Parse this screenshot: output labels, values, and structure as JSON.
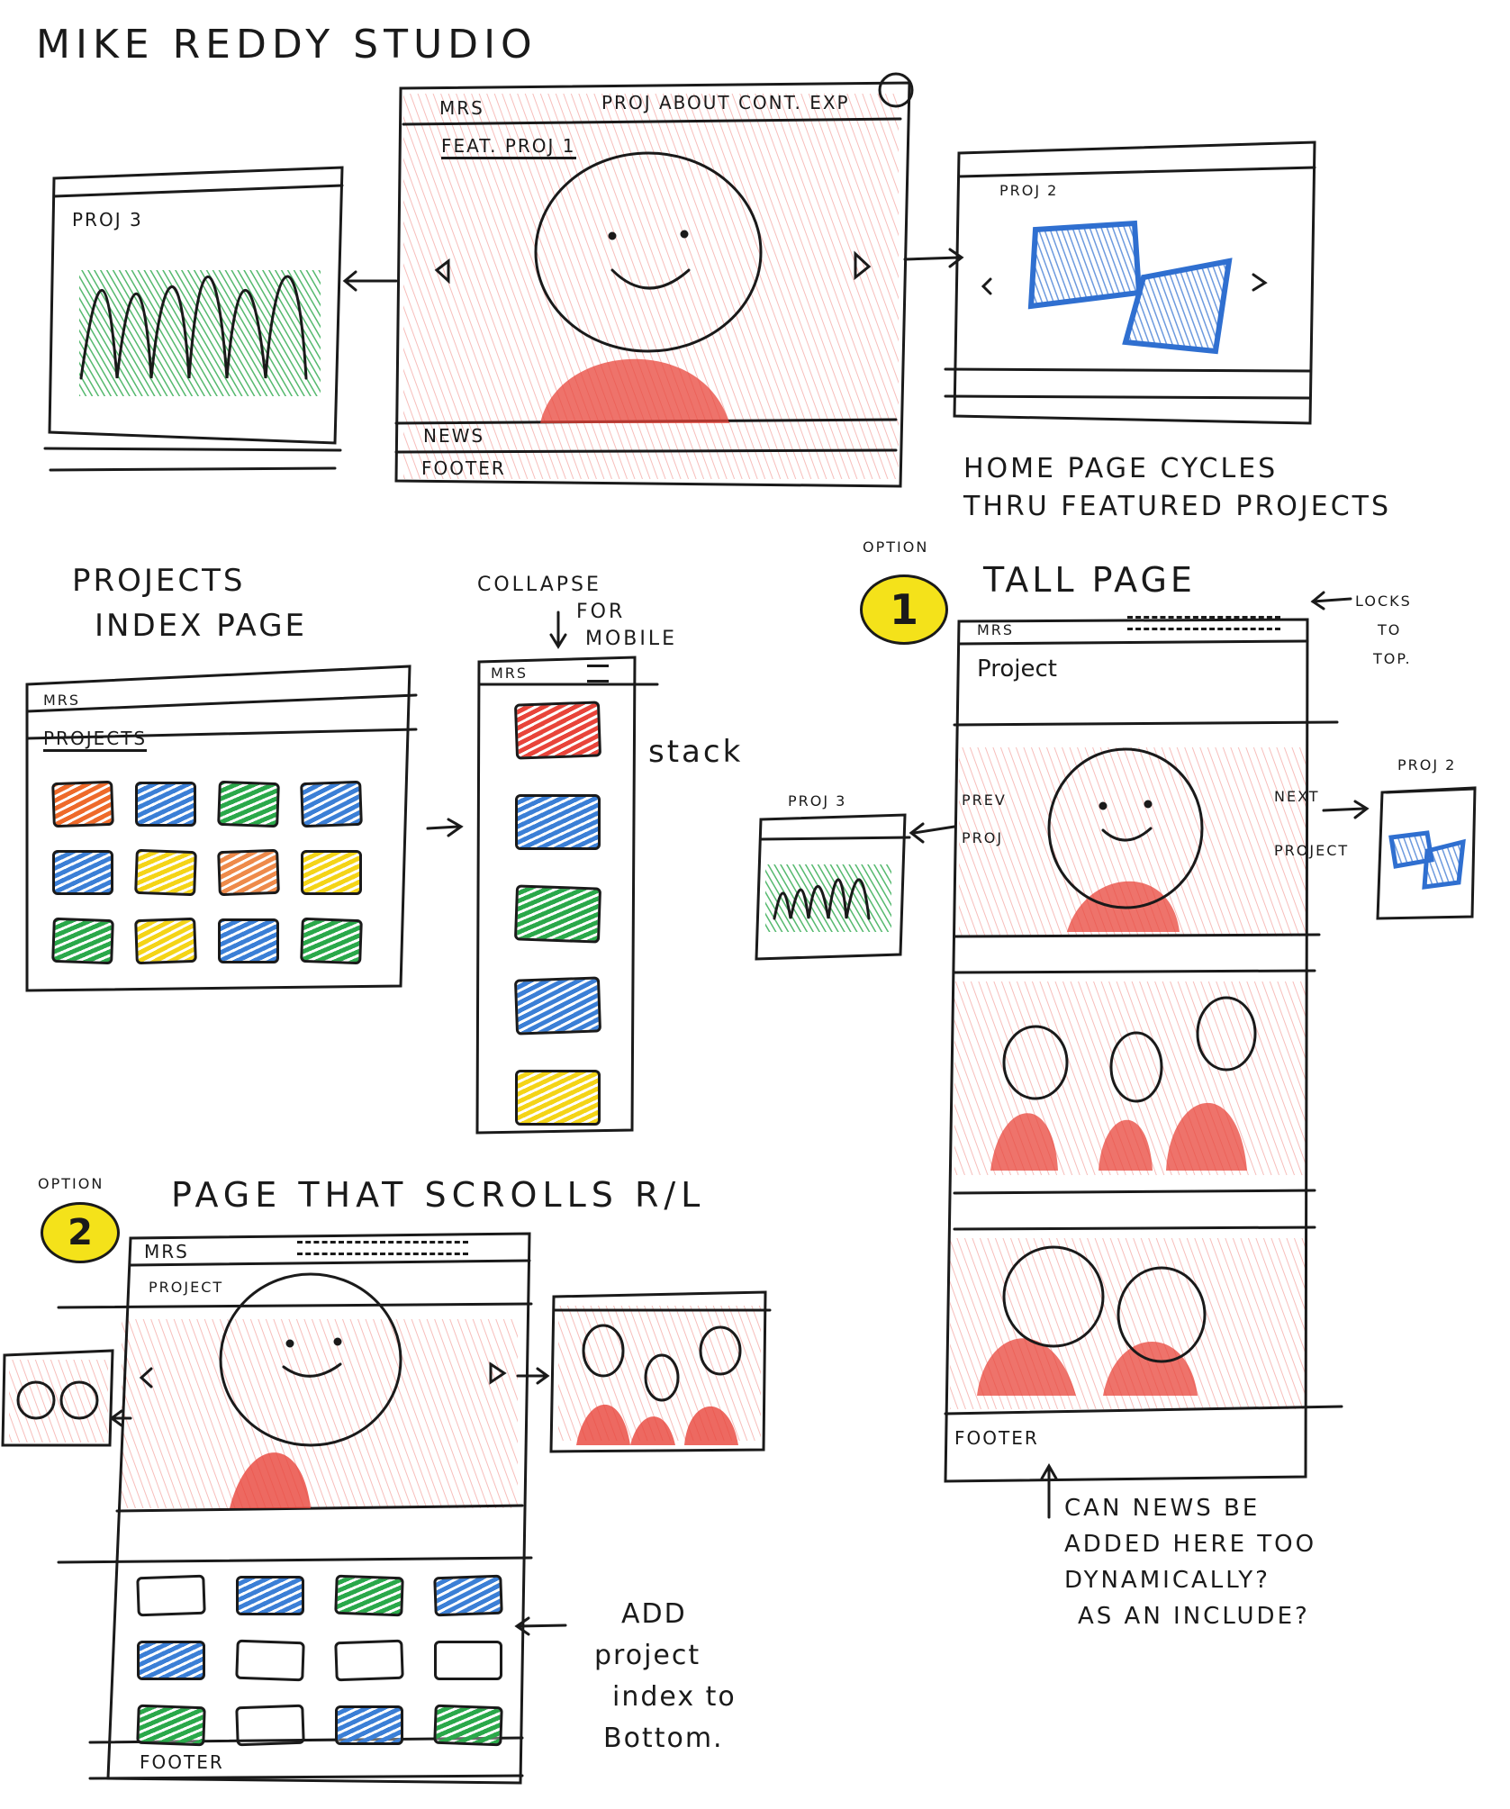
{
  "title": "MIKE REDDY STUDIO",
  "home_sketch": {
    "logo": "MRS",
    "nav": "PROJ ABOUT CONT. EXP",
    "featured_label": "FEAT. PROJ 1",
    "news_label": "NEWS",
    "footer_label": "FOOTER",
    "left_card_label": "PROJ 3",
    "right_card_label": "PROJ 2",
    "note_line1": "HOME PAGE CYCLES",
    "note_line2": "THRU FEATURED PROJECTS"
  },
  "index_sketch": {
    "heading_line1": "PROJECTS",
    "heading_line2": "INDEX PAGE",
    "logo": "MRS",
    "projects_label": "PROJECTS",
    "collapse_note_line1": "COLLAPSE",
    "collapse_note_line2": "FOR",
    "collapse_note_line3": "MOBILE",
    "mobile_logo": "MRS",
    "stack_label": "stack",
    "tile_colors": [
      "#ee6a2a",
      "#3b7fd6",
      "#2aa84a",
      "#3b7fd6",
      "#3b7fd6",
      "#f4d417",
      "#ee8a4a",
      "#f4d417",
      "#2aa84a",
      "#f4d417",
      "#3b7fd6",
      "#2aa84a"
    ],
    "stack_colors": [
      "#e8443a",
      "#3b7fd6",
      "#2aa84a",
      "#3b7fd6",
      "#f4d417"
    ]
  },
  "option1": {
    "badge_label": "OPTION",
    "badge_number": "1",
    "heading": "TALL PAGE",
    "logo": "MRS",
    "project_label": "Project",
    "prev_line1": "PREV",
    "prev_line2": "PROJ",
    "next_line1": "NEXT",
    "next_line2": "PROJECT",
    "left_card_label": "PROJ 3",
    "right_card_label": "PROJ 2",
    "locks_line1": "LOCKS",
    "locks_line2": "TO",
    "locks_line3": "TOP.",
    "footer_label": "FOOTER",
    "question_line1": "CAN NEWS BE",
    "question_line2": "ADDED HERE TOO",
    "question_line3": "DYNAMICALLY?",
    "question_line4": "AS AN INCLUDE?"
  },
  "option2": {
    "badge_label": "OPTION",
    "badge_number": "2",
    "heading": "PAGE THAT SCROLLS R/L",
    "logo": "MRS",
    "project_label": "PROJECT",
    "footer_label": "FOOTER",
    "add_line1": "ADD",
    "add_line2": "project",
    "add_line3": "index to",
    "add_line4": "Bottom.",
    "tile_colors": [
      "",
      "#3b7fd6",
      "#2aa84a",
      "#3b7fd6",
      "#3b7fd6",
      "",
      "",
      "",
      "#2aa84a",
      "",
      "#3b7fd6",
      "#2aa84a"
    ]
  },
  "colors": {
    "ink": "#1a1a1a",
    "red": "#e8443a",
    "orange": "#f08a3c",
    "green": "#2aa84a",
    "blue": "#2f6fd0",
    "yellow": "#f4e21a"
  }
}
